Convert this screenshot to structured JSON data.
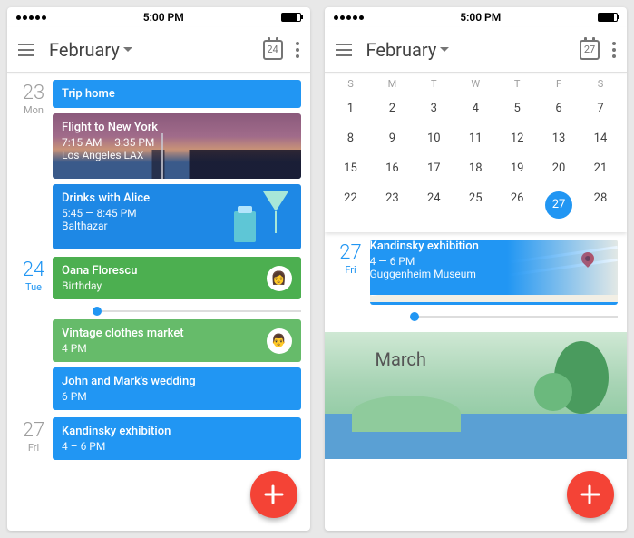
{
  "status": {
    "time": "5:00 PM"
  },
  "left": {
    "month": "February",
    "today": "24",
    "days": [
      {
        "num": "23",
        "day": "Mon",
        "active": false,
        "events": [
          {
            "kind": "title",
            "color": "#2196f3",
            "title": "Trip home"
          },
          {
            "kind": "ny",
            "title": "Flight to New York",
            "time": "7:15 AM – 3:35 PM",
            "loc": "Los Angeles LAX"
          },
          {
            "kind": "drinks",
            "title": "Drinks with Alice",
            "time": "5:45 — 8:45 PM",
            "loc": "Balthazar"
          }
        ]
      },
      {
        "num": "24",
        "day": "Tue",
        "active": true,
        "nowline": true,
        "events": [
          {
            "kind": "plain",
            "color": "#4caf50",
            "title": "Oana Florescu",
            "time": "Birthday",
            "avatar": "👩"
          },
          {
            "kind": "plain",
            "color": "#66bb6a",
            "title": "Vintage clothes market",
            "time": "4 PM",
            "avatar": "👨"
          },
          {
            "kind": "plain",
            "color": "#2196f3",
            "title": "John and Mark's wedding",
            "time": "6 PM"
          }
        ]
      },
      {
        "num": "27",
        "day": "Fri",
        "active": false,
        "events": [
          {
            "kind": "map-peek",
            "title": "Kandinsky exhibition",
            "time": "4 – 6 PM"
          }
        ]
      }
    ]
  },
  "right": {
    "month": "February",
    "today": "27",
    "weekdays": [
      "S",
      "M",
      "T",
      "W",
      "T",
      "F",
      "S"
    ],
    "weeks": [
      [
        "1",
        "2",
        "3",
        "4",
        "5",
        "6",
        "7"
      ],
      [
        "8",
        "9",
        "10",
        "11",
        "12",
        "13",
        "14"
      ],
      [
        "15",
        "16",
        "17",
        "18",
        "19",
        "20",
        "21"
      ],
      [
        "22",
        "23",
        "24",
        "25",
        "26",
        "27",
        "28"
      ]
    ],
    "selected": "27",
    "day": {
      "num": "27",
      "day": "Fri",
      "event": {
        "title": "Kandinsky exhibition",
        "time": "4 — 6 PM",
        "loc": "Guggenheim Museum"
      }
    },
    "nextMonth": "March"
  }
}
